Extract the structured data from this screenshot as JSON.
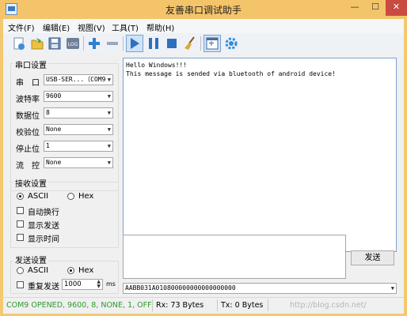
{
  "window": {
    "title": "友善串口调试助手",
    "min_glyph": "—",
    "max_glyph": "☐",
    "close_glyph": "✕"
  },
  "menu": [
    "文件(F)",
    "编辑(E)",
    "视图(V)",
    "工具(T)",
    "帮助(H)"
  ],
  "toolbar": {
    "icons": [
      "new-icon",
      "open-folder-icon",
      "save-icon",
      "log-icon",
      "add-icon",
      "remove-icon",
      "play-icon",
      "pause-icon",
      "stop-icon",
      "clear-broom-icon",
      "window-icon",
      "settings-gear-icon"
    ],
    "log_text": "LOG"
  },
  "serial": {
    "group_title": "串口设置",
    "port_label": "串　口",
    "port_value": "USB-SER...（COM9",
    "baud_label": "波特率",
    "baud_value": "9600",
    "databits_label": "数据位",
    "databits_value": "8",
    "parity_label": "校验位",
    "parity_value": "None",
    "stopbits_label": "停止位",
    "stopbits_value": "1",
    "flow_label": "流　控",
    "flow_value": "None"
  },
  "receive": {
    "group_title": "接收设置",
    "ascii_label": "ASCII",
    "hex_label": "Hex",
    "mode_selected": "ASCII",
    "auto_wrap": "自动换行",
    "show_send": "显示发送",
    "show_time": "显示时间"
  },
  "send": {
    "group_title": "发送设置",
    "ascii_label": "ASCII",
    "hex_label": "Hex",
    "mode_selected": "Hex",
    "repeat_label": "重复发送",
    "repeat_value": "1000",
    "repeat_unit": "ms",
    "send_button": "发送",
    "history_value": "AABB031A010800000000000000000"
  },
  "receive_text": "Hello Windows!!!\nThis message is sended via bluetooth of android device!",
  "status": {
    "connection": "COM9 OPENED, 9600, 8, NONE, 1, OFF",
    "rx": "Rx: 73 Bytes",
    "tx": "Tx: 0 Bytes",
    "watermark": "http://blog.csdn.net/",
    "connection_color": "#2e9a2e"
  }
}
